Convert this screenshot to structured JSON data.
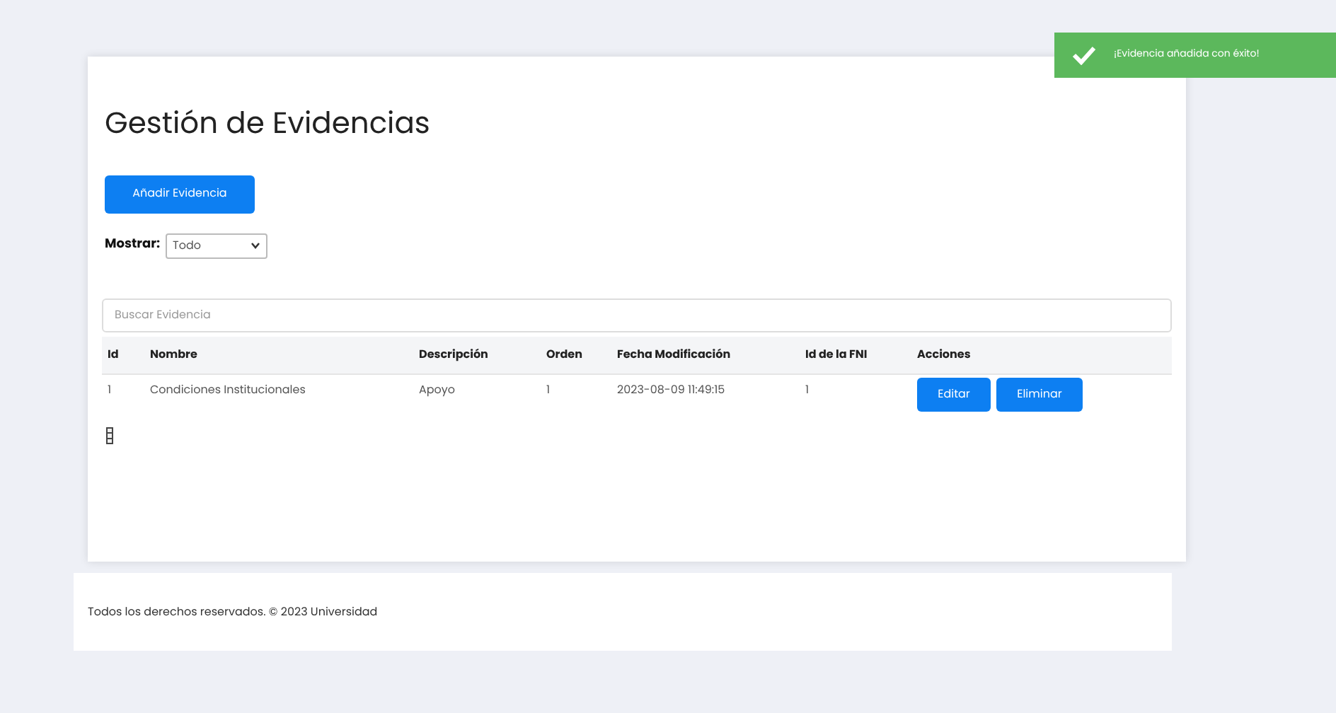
{
  "title": "Gestión de Evidencias",
  "add_button": "Añadir Evidencia",
  "filter": {
    "label": "Mostrar:",
    "value": "Todo"
  },
  "search": {
    "placeholder": "Buscar Evidencia"
  },
  "table": {
    "columns": [
      "Id",
      "Nombre",
      "Descripción",
      "Orden",
      "Fecha Modificación",
      "Id de la FNI",
      "Acciones"
    ],
    "rows": [
      {
        "cells": [
          "1",
          "Condiciones Institucionales",
          "Apoyo",
          "1",
          "2023-08-09 11:49:15",
          "1"
        ],
        "actions": [
          "Editar",
          "Eliminar"
        ]
      }
    ]
  },
  "footer": "Todos los derechos reservados. © 2023 Universidad",
  "toast": {
    "message": "¡Evidencia añadida con éxito!"
  }
}
